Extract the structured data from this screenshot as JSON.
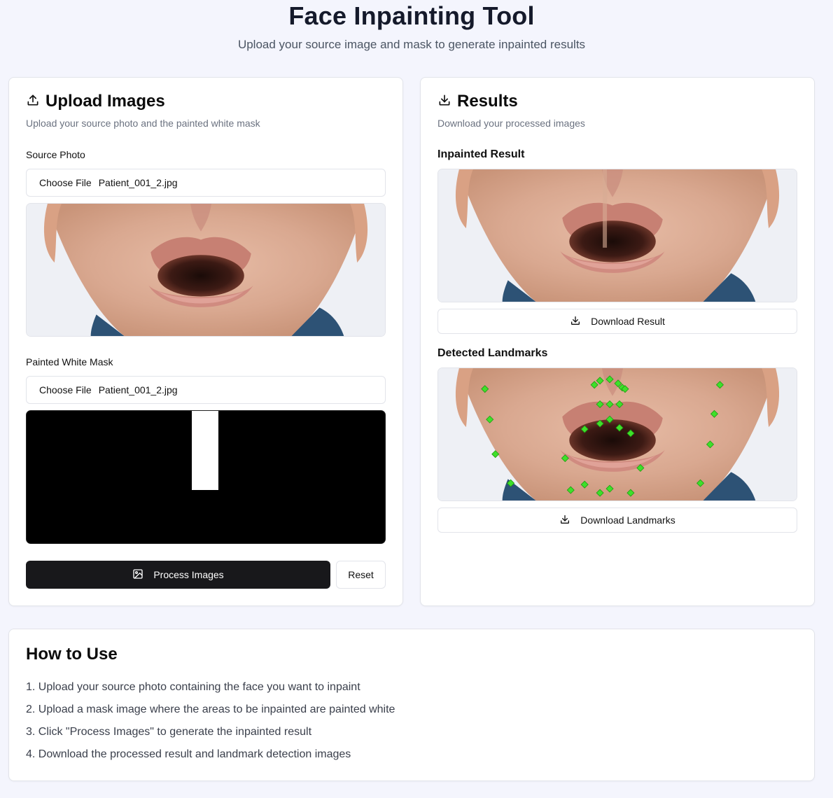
{
  "header": {
    "title": "Face Inpainting Tool",
    "subtitle": "Upload your source image and mask to generate inpainted results"
  },
  "upload": {
    "title": "Upload Images",
    "description": "Upload your source photo and the painted white mask",
    "source_label": "Source Photo",
    "source_button": "Choose File",
    "source_filename": "Patient_001_2.jpg",
    "mask_label": "Painted White Mask",
    "mask_button": "Choose File",
    "mask_filename": "Patient_001_2.jpg",
    "process_label": "Process Images",
    "reset_label": "Reset"
  },
  "results": {
    "title": "Results",
    "description": "Download your processed images",
    "inpainted_label": "Inpainted Result",
    "download_result_label": "Download Result",
    "landmarks_label": "Detected Landmarks",
    "download_landmarks_label": "Download Landmarks"
  },
  "how_to": {
    "title": "How to Use",
    "steps": [
      "1. Upload your source photo containing the face you want to inpaint",
      "2. Upload a mask image where the areas to be inpainted are painted white",
      "3. Click \"Process Images\" to generate the inpainted result",
      "4. Download the processed result and landmark detection images"
    ]
  },
  "colors": {
    "page_bg": "#f4f5fd",
    "primary_button": "#18181b",
    "landmark_marker": "#3ee02a"
  },
  "icons": {
    "upload": "upload-icon",
    "download": "download-icon",
    "image": "image-icon"
  }
}
